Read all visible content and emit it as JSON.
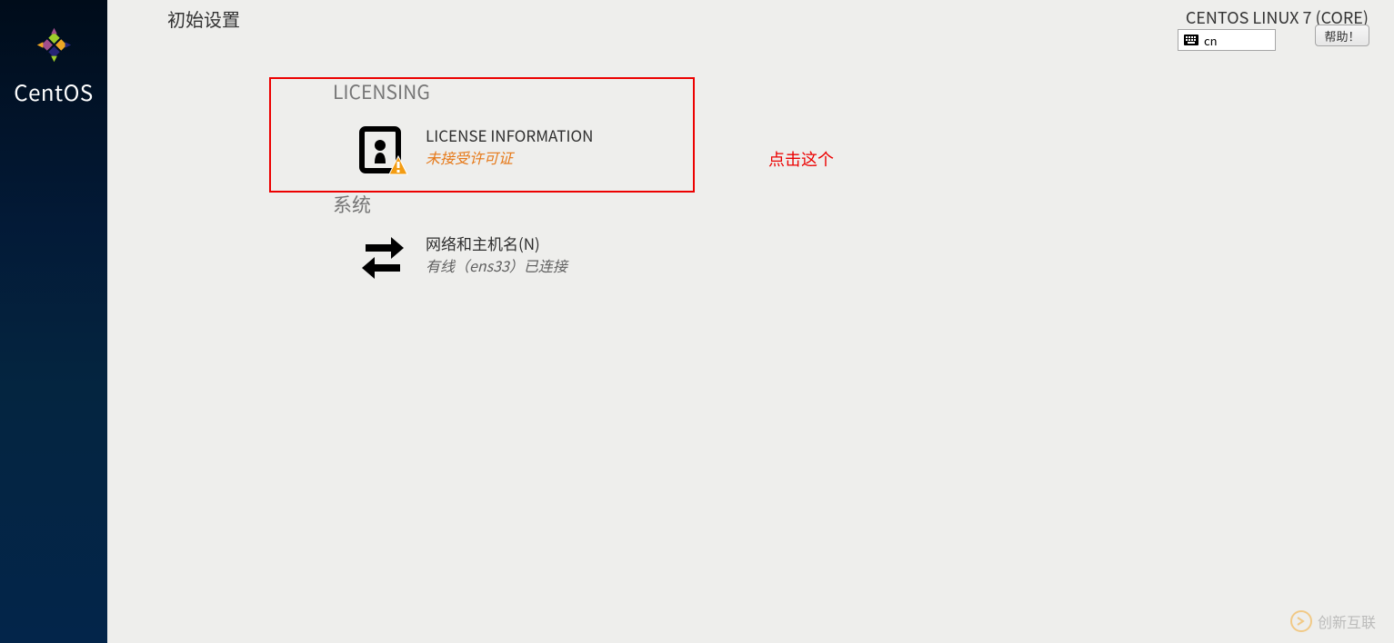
{
  "sidebar": {
    "brand": "CentOS"
  },
  "header": {
    "title": "初始设置",
    "os": "CENTOS LINUX 7 (CORE)",
    "language": "cn",
    "help": "帮助！"
  },
  "sections": {
    "licensing": {
      "heading": "LICENSING",
      "license": {
        "title": "LICENSE INFORMATION",
        "status": "未接受许可证"
      }
    },
    "system": {
      "heading": "系统",
      "network": {
        "title": "网络和主机名(N)",
        "status": "有线（ens33）已连接"
      }
    }
  },
  "annotation": "点击这个",
  "watermark": "创新互联"
}
